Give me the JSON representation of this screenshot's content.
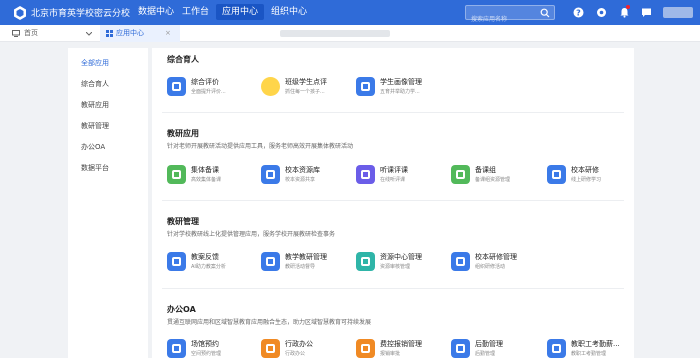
{
  "header": {
    "title": "北京市育英学校密云分校",
    "nav": [
      "数据中心",
      "工作台",
      "应用中心",
      "组织中心"
    ],
    "active_nav": "应用中心",
    "search_placeholder": "搜索应用名称",
    "icons": [
      "help-icon",
      "settings-icon",
      "bell-icon",
      "message-icon"
    ]
  },
  "tabs": {
    "home": "首页",
    "app": "应用中心",
    "close": "×"
  },
  "sidebar": {
    "items": [
      "全部应用",
      "综合育人",
      "教研应用",
      "教研管理",
      "办公OA",
      "数据平台"
    ]
  },
  "sections": [
    {
      "title": "综合育人",
      "desc": "",
      "cards": [
        {
          "name": "综合评价",
          "sub": "全面提升评价...",
          "color": "blue",
          "icon": "evaluation-icon"
        },
        {
          "name": "班级学生点评",
          "sub": "抓住每一个孩子...",
          "color": "mascot",
          "icon": "student-mascot-icon"
        },
        {
          "name": "学生画像管理",
          "sub": "五育并举助力学...",
          "color": "blue",
          "icon": "portrait-icon"
        }
      ]
    },
    {
      "title": "教研应用",
      "desc": "针对老师开展教研活动提供应用工具，服务老师高效开展集体教研活动",
      "cards": [
        {
          "name": "集体备课",
          "sub": "高效集体备课",
          "color": "green",
          "icon": "lesson-prep-icon"
        },
        {
          "name": "校本资源库",
          "sub": "校本资源共享",
          "color": "blue",
          "icon": "resource-library-icon"
        },
        {
          "name": "听课评课",
          "sub": "在线听评课",
          "color": "purple",
          "icon": "lesson-review-icon"
        },
        {
          "name": "备课组",
          "sub": "备课组资源管理",
          "color": "green",
          "icon": "prep-group-icon"
        },
        {
          "name": "校本研修",
          "sub": "线上研修学习",
          "color": "blue",
          "icon": "training-icon"
        }
      ]
    },
    {
      "title": "教研管理",
      "desc": "针对学校教研线上化提供管理应用，服务学校开展教研检查事务",
      "cards": [
        {
          "name": "教案反馈",
          "sub": "AI助力教案分析",
          "color": "blue",
          "icon": "lesson-plan-feedback-icon"
        },
        {
          "name": "教学教研管理",
          "sub": "教研活动督导",
          "color": "blue",
          "icon": "teaching-management-icon"
        },
        {
          "name": "资源中心管理",
          "sub": "资源审核管理",
          "color": "teal",
          "icon": "resource-center-icon"
        },
        {
          "name": "校本研修管理",
          "sub": "组织研修活动",
          "color": "blue",
          "icon": "training-management-icon"
        }
      ]
    },
    {
      "title": "办公OA",
      "desc": "贯通互联网应用和区域智慧教育应用融合生态，助力区域智慧教育可持续发展",
      "cards": [
        {
          "name": "场馆预约",
          "sub": "空间预约管理",
          "color": "blue",
          "icon": "venue-booking-icon"
        },
        {
          "name": "行政办公",
          "sub": "行政办公",
          "color": "orange",
          "icon": "office-icon"
        },
        {
          "name": "费控报销管理",
          "sub": "报销审批",
          "color": "orange",
          "icon": "expense-icon"
        },
        {
          "name": "后勤管理",
          "sub": "后勤管理",
          "color": "blue",
          "icon": "logistics-icon"
        },
        {
          "name": "教职工考勤薪...",
          "sub": "教职工考勤管理",
          "color": "blue",
          "icon": "attendance-icon"
        }
      ]
    }
  ]
}
